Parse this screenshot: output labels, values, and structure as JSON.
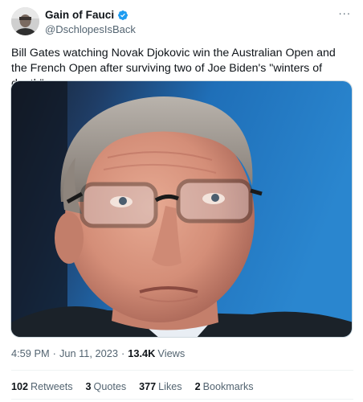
{
  "author": {
    "display_name": "Gain of Fauci",
    "handle": "@DschlopesIsBack",
    "verified_badge_icon": "verified-badge-icon",
    "avatar_icon": "user-avatar"
  },
  "more_icon": "more-options-icon",
  "more_label": "···",
  "tweet": {
    "text": "Bill Gates watching Novak Djokovic win the Australian Open and the French Open after surviving two of Joe Biden's \"winters of death\""
  },
  "media": {
    "image_icon": "photo-of-man-with-glasses"
  },
  "meta": {
    "time": "4:59 PM",
    "separator": "·",
    "date": "Jun 11, 2023",
    "views_count": "13.4K",
    "views_label": "Views"
  },
  "stats": {
    "retweets": {
      "count": "102",
      "label": "Retweets"
    },
    "quotes": {
      "count": "3",
      "label": "Quotes"
    },
    "likes": {
      "count": "377",
      "label": "Likes"
    },
    "bookmarks": {
      "count": "2",
      "label": "Bookmarks"
    }
  },
  "colors": {
    "text_primary": "#0f1419",
    "text_secondary": "#536471",
    "verified_blue": "#1d9bf0",
    "divider": "#eff3f4"
  }
}
